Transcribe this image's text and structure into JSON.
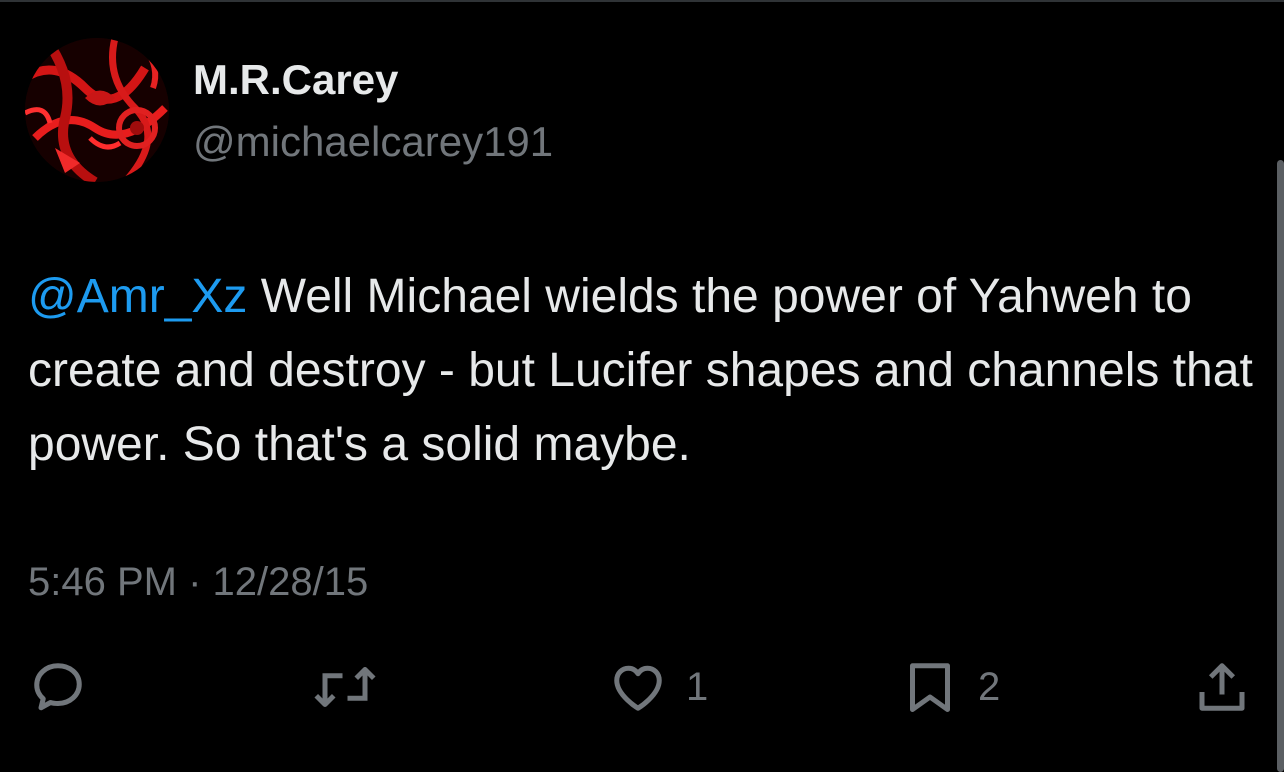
{
  "author": {
    "display_name": "M.R.Carey",
    "handle": "@michaelcarey191"
  },
  "tweet": {
    "mention": "@Amr_Xz",
    "text": " Well Michael wields the power of Yahweh to create and destroy - but Lucifer shapes and channels that power. So that's a solid maybe.",
    "time": "5:46 PM",
    "separator": "·",
    "date": "12/28/15"
  },
  "actions": {
    "reply_icon": "reply-icon",
    "retweet_icon": "retweet-icon",
    "like_icon": "heart-icon",
    "like_count": "1",
    "bookmark_icon": "bookmark-icon",
    "bookmark_count": "2",
    "share_icon": "share-icon"
  },
  "colors": {
    "background": "#000000",
    "text_primary": "#e7e9ea",
    "text_secondary": "#71767b",
    "accent": "#1d9bf0"
  }
}
